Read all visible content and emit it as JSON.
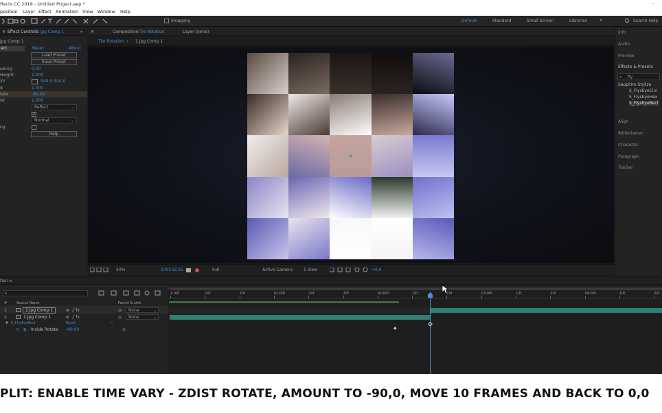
{
  "window_title": "ffects CC 2018 - Untitled Project.aep *",
  "menu": [
    "position",
    "Layer",
    "Effect",
    "Animation",
    "View",
    "Window",
    "Help"
  ],
  "toolbar": {
    "snapping": "Snapping",
    "workspaces": [
      "Default",
      "Standard",
      "Small Screen",
      "Libraries"
    ],
    "search_help": "Search Help"
  },
  "effect_controls": {
    "tab": "Effect Controls",
    "layer": "2.jpg Comp 1",
    "comp_line": "jpg Comp 1",
    "effect_name": "ect",
    "reset": "Reset",
    "about": "About",
    "load_preset": "Load Preset",
    "save_preset": "Save Preset",
    "params": [
      {
        "name": "uency",
        "value": "0,00"
      },
      {
        "name": "Height",
        "value": "1,000"
      },
      {
        "name": "XY",
        "value": "540,0,540,0"
      },
      {
        "name": "d",
        "value": "1,000"
      },
      {
        "name": "tate",
        "value": "-90,00"
      },
      {
        "name": "ist",
        "value": "1,000"
      },
      {
        "name": "",
        "value": "Reflect"
      },
      {
        "name": "",
        "value": ""
      },
      {
        "name": "",
        "value": "Normal"
      },
      {
        "name": "ng",
        "value": ""
      }
    ],
    "help": "Help"
  },
  "composition": {
    "tab": "Composition",
    "comp_name": "Tile Rotation",
    "layer_tab": "Layer (none)",
    "sub_tabs": [
      "Tile Rotation",
      "1.jpg Comp 1"
    ],
    "zoom": "50%",
    "timecode": "0;00;02;15",
    "resolution": "Full",
    "camera": "Active Camera",
    "views": "1 View",
    "exposure": "+0,0"
  },
  "right_panel": {
    "items": [
      "Info",
      "Audio",
      "Preview",
      "Effects & Presets"
    ],
    "search": "fly",
    "group": "Sapphire Stylize",
    "effects": [
      "S_FlysEyeCirc",
      "S_FlysEyeHex",
      "S_FlysEyeRect"
    ],
    "items2": [
      "Align",
      "Bibliotheken",
      "Character",
      "Paragraph",
      "Tracker"
    ]
  },
  "timeline": {
    "tab": "tion",
    "cols": [
      "#",
      "Source Name",
      "Parent & Link"
    ],
    "layers": [
      {
        "num": "1",
        "name": "2.jpg Comp 1",
        "parent": "None"
      },
      {
        "num": "2",
        "name": "1.jpg Comp 1",
        "parent": "None"
      }
    ],
    "effect": "S_FlysEyeRect",
    "effect_reset": "Reset",
    "prop_name": "Inside Rotate",
    "prop_value": "-90,00",
    "ruler": [
      "1:00f",
      "10f",
      "20f",
      "01:00f",
      "10f",
      "20f",
      "02:00f",
      "10f",
      "20f",
      "03:00f",
      "10f",
      "20f",
      "04:00f",
      "10f",
      "20f"
    ]
  },
  "caption": "PLIT: ENABLE TIME VARY - ZDIST ROTATE, AMOUNT TO -90,0, MOVE 10 FRAMES AND BACK TO 0,0",
  "colors": {
    "accent": "#3a8fe0",
    "track": "#2f7f74"
  }
}
